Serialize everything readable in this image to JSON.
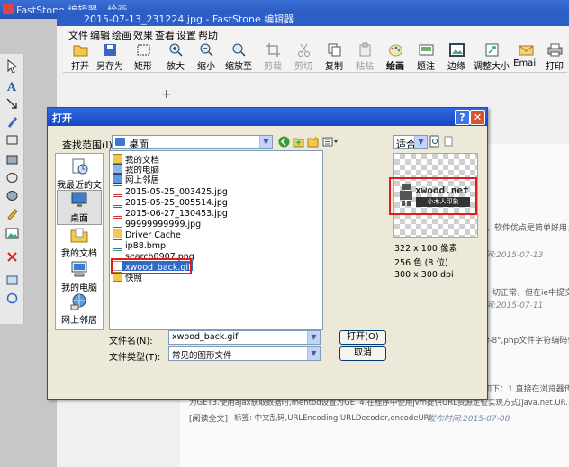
{
  "outer": {
    "title": "FastStone 编辑器 - 绘画",
    "subtitle": "2015-07-13_231224.jpg - FastStone 编辑器"
  },
  "menu": [
    "文件",
    "编辑",
    "绘画",
    "效果",
    "查看",
    "设置",
    "帮助"
  ],
  "toolbar": {
    "open": "打开",
    "saveas": "另存为",
    "rect": "矩形",
    "zoomin": "放大",
    "zoomout": "缩小",
    "zoomto": "缩放至",
    "crop": "剪裁",
    "cut": "剪切",
    "copy": "复制",
    "paste": "粘贴",
    "draw": "绘画",
    "caption": "题注",
    "border": "边缘",
    "resize": "调整大小",
    "email": "Email",
    "print": "打印"
  },
  "background_page": {
    "line1": "，软件优点是简单好用，",
    "date1": "发布时间:2015-07-13",
    "line2": "一切正常，但在ie中提交事",
    "date2": "发布时间:2015-07-11",
    "line3": "tf-8\",php文件字符编码作",
    "line4": "如下：1.直接在浏览器传",
    "line5": "为GET3.使用ajax获取数据时,mehtod设置为GET4.在程序中使用jvm提供URL资源定位实现方式(java.net.UR..",
    "read_more": "[阅读全文]",
    "tags": "标签: 中文乱码,URLEncoding,URLDecoder,encodeURI",
    "date3": "发布时间:2015-07-08"
  },
  "dialog": {
    "title": "打开",
    "help": "?",
    "close": "✕",
    "lookin_label": "查找范围(I):",
    "lookin_value": "桌面",
    "places": [
      "我最近的文档",
      "桌面",
      "我的文档",
      "我的电脑",
      "网上邻居"
    ],
    "files": [
      "我的文档",
      "我的电脑",
      "网上邻居",
      "2015-05-25_003425.jpg",
      "2015-05-25_005514.jpg",
      "2015-06-27_130453.jpg",
      "99999999999.jpg",
      "Driver Cache",
      "ip88.bmp",
      "search0907.png",
      "xwood_back.gif",
      "快照"
    ],
    "selected_file": "xwood_back.gif",
    "preview_fit": "适合",
    "logo_text": "xwood.net",
    "logo_sub": "小木人印象",
    "image_size": "322 x 100 像素",
    "image_colors": "256 色 (8 位)",
    "image_dpi": "300 x 300 dpi",
    "filename_label": "文件名(N):",
    "filename_value": "xwood_back.gif",
    "filetype_label": "文件类型(T):",
    "filetype_value": "常见的图形文件",
    "open_button": "打开(O)",
    "cancel_button": "取消"
  }
}
